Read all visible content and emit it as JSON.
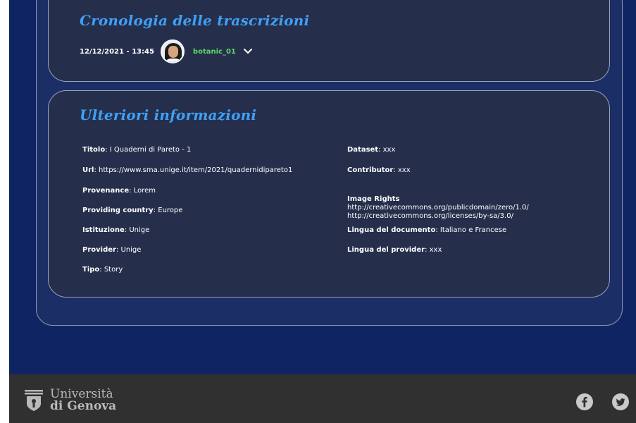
{
  "history": {
    "title": "Cronologia delle trascrizioni",
    "entry": {
      "datetime": "12/12/2021 - 13:45",
      "username": "botanic_01"
    }
  },
  "info": {
    "title": "Ulteriori informazioni",
    "left": [
      {
        "label": "Titolo",
        "value": ": I Quaderni di Pareto - 1"
      },
      {
        "label": "Url",
        "value": ": https://www.sma.unige.it/item/2021/quadernidipareto1"
      },
      {
        "label": "Provenance",
        "value": ": Lorem"
      },
      {
        "label": "Providing country",
        "value": ": Europe"
      },
      {
        "label": "Istituzione",
        "value": ": Unige"
      },
      {
        "label": "Provider",
        "value": ": Unige"
      },
      {
        "label": "Tipo",
        "value": ": Story"
      }
    ],
    "right": [
      {
        "label": "Dataset",
        "value": ": xxx"
      },
      {
        "label": "Contributor",
        "value": ": xxx"
      },
      {
        "label": "Image Rights",
        "value": " http://creativecommons.org/publicdomain/zero/1.0/\nhttp://creativecommons.org/licenses/by-sa/3.0/"
      },
      {
        "label": "Lingua del documento",
        "value": ": Italiano e Francese"
      },
      {
        "label": "Lingua del provider",
        "value": ": xxx"
      }
    ]
  },
  "footer": {
    "logo_line1": "Università",
    "logo_line2": "di Genova",
    "icons": [
      "facebook-icon",
      "twitter-icon"
    ]
  },
  "colors": {
    "page_bg": "#0f2563",
    "card_bg": "#252f4c",
    "title_blue": "#3fa0f5",
    "username_green": "#5ed66a",
    "footer_bg": "#303030"
  }
}
